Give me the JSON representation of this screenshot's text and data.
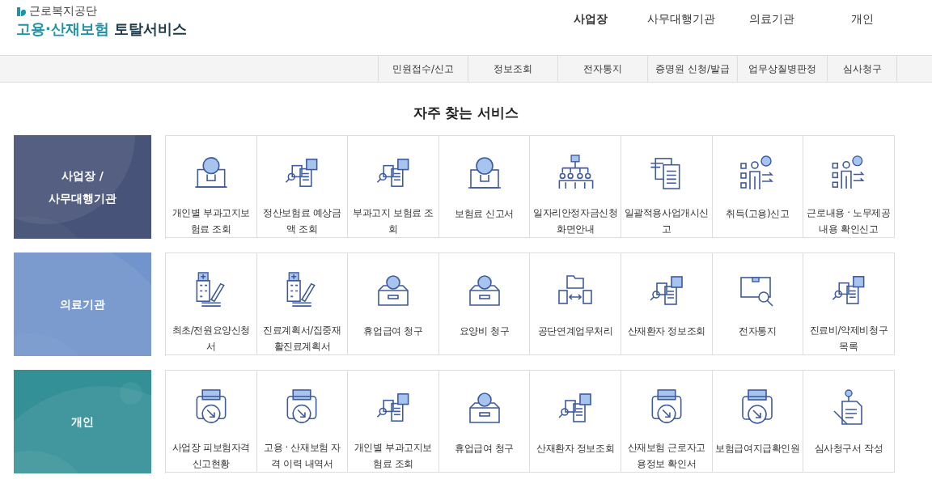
{
  "logo": {
    "org": "근로복지공단",
    "title_accent": "고용·산재보험",
    "title_rest": "토탈서비스"
  },
  "main_nav": [
    {
      "label": "사업장",
      "selected": true
    },
    {
      "label": "사무대행기관",
      "selected": false
    },
    {
      "label": "의료기관",
      "selected": false
    },
    {
      "label": "개인",
      "selected": false
    }
  ],
  "sub_nav": [
    "민원접수/신고",
    "정보조회",
    "전자통지",
    "증명원 신청/발급",
    "업무상질병판정",
    "심사청구"
  ],
  "section_title": "자주 찾는 서비스",
  "categories": [
    {
      "label": "사업장 /\n사무대행기관",
      "color": "#475378",
      "services": [
        {
          "label": "개인별 부과고지보험료 조회",
          "kind": "laptop"
        },
        {
          "label": "정산보험료 예상금액 조회",
          "kind": "receipt"
        },
        {
          "label": "부과고지 보험료 조회",
          "kind": "receipt"
        },
        {
          "label": "보험료 신고서",
          "kind": "laptop"
        },
        {
          "label": "일자리안정자금신청화면안내",
          "kind": "org"
        },
        {
          "label": "일괄적용사업개시신고",
          "kind": "document"
        },
        {
          "label": "취득(고용)신고",
          "kind": "person"
        },
        {
          "label": "근로내용 · 노무제공내용 확인신고",
          "kind": "person"
        }
      ]
    },
    {
      "label": "의료기관",
      "color": "#7294cc",
      "services": [
        {
          "label": "최초/전원요양신청서",
          "kind": "hospital"
        },
        {
          "label": "진료계획서/집중재활진료계획서",
          "kind": "hospital"
        },
        {
          "label": "휴업급여 청구",
          "kind": "coinbox"
        },
        {
          "label": "요양비 청구",
          "kind": "coinbox"
        },
        {
          "label": "공단연계업무처리",
          "kind": "folder"
        },
        {
          "label": "산재환자 정보조회",
          "kind": "receipt"
        },
        {
          "label": "전자통지",
          "kind": "parcel"
        },
        {
          "label": "진료비/약제비청구목록",
          "kind": "receipt"
        }
      ]
    },
    {
      "label": "개인",
      "color": "#339096",
      "services": [
        {
          "label": "사업장 피보험자격신고현황",
          "kind": "printer"
        },
        {
          "label": "고용 · 산재보험 자격 이력 내역서",
          "kind": "printer"
        },
        {
          "label": "개인별 부과고지보험료 조회",
          "kind": "receipt"
        },
        {
          "label": "휴업급여 청구",
          "kind": "coinbox"
        },
        {
          "label": "산재환자 정보조회",
          "kind": "receipt"
        },
        {
          "label": "산재보험 근로자고용정보 확인서",
          "kind": "printer"
        },
        {
          "label": "보험급여지급확인원",
          "kind": "printer"
        },
        {
          "label": "심사청구서 작성",
          "kind": "pin"
        }
      ]
    }
  ]
}
